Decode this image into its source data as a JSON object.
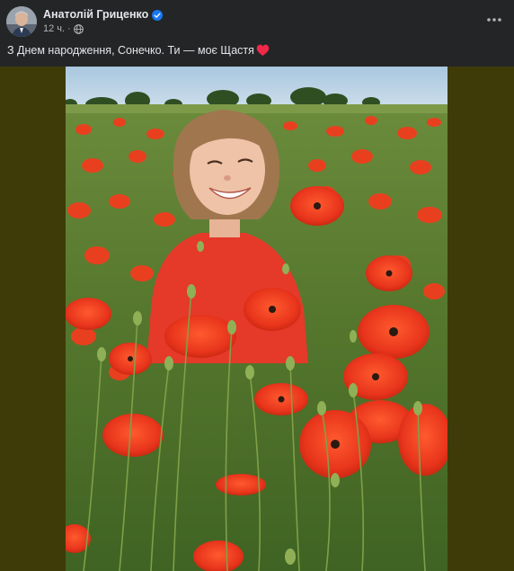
{
  "post": {
    "author": "Анатолій Гриценко",
    "time": "12 ч.",
    "text": "З Днем народження, Сонечко. Ти — моє Щастя",
    "verified": true,
    "audience_icon": "globe-icon",
    "emoji": "red-heart"
  },
  "colors": {
    "background": "#242526",
    "media_background": "#3f3b09",
    "verified_badge": "#1877f2",
    "heart": "#f02849",
    "poppy": "#e8351c"
  }
}
